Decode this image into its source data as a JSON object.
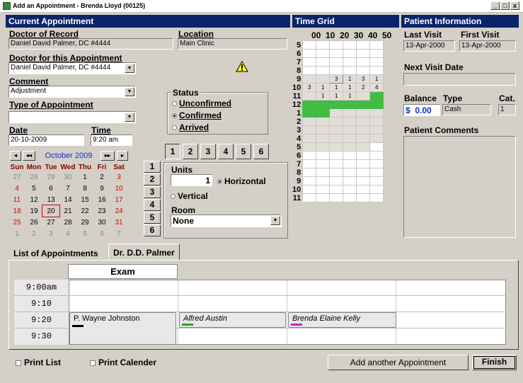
{
  "window": {
    "title": "Add an Appointment - Brenda Lloyd    (00125)",
    "min": "_",
    "max": "□",
    "close": "x"
  },
  "current_appointment": {
    "header": "Current Appointment",
    "doctor_of_record_label": "Doctor of Record",
    "doctor_of_record_value": "Daniel David Palmer, DC #4444",
    "location_label": "Location",
    "location_value": "Main Clinic",
    "doctor_appt_label": "Doctor for this Appointment",
    "doctor_appt_value": "Daniel David Palmer, DC #4444",
    "comment_label": "Comment",
    "comment_value": "Adjustment",
    "type_label": "Type of Appointment",
    "type_value": "",
    "date_label": "Date",
    "date_value": "20-10-2009",
    "time_label": "Time",
    "time_value": "9:20 am",
    "warning_icon": "warning-icon",
    "status": {
      "label": "Status",
      "options": [
        "Unconfirmed",
        "Confirmed",
        "Arrived"
      ],
      "selected": "Confirmed"
    }
  },
  "calendar": {
    "month_label": "October 2009",
    "nav": {
      "prev": "◂",
      "prev_fast": "◂◂",
      "next_fast": "▸▸",
      "next": "▸"
    },
    "weekdays": [
      "Sun",
      "Mon",
      "Tue",
      "Wed",
      "Thu",
      "Fri",
      "Sat"
    ],
    "weeks": [
      [
        "27",
        "28",
        "29",
        "30",
        "1",
        "2",
        "3"
      ],
      [
        "4",
        "5",
        "6",
        "7",
        "8",
        "9",
        "10"
      ],
      [
        "11",
        "12",
        "13",
        "14",
        "15",
        "16",
        "17"
      ],
      [
        "18",
        "19",
        "20",
        "21",
        "22",
        "23",
        "24"
      ],
      [
        "25",
        "26",
        "27",
        "28",
        "29",
        "30",
        "31"
      ],
      [
        "1",
        "2",
        "3",
        "4",
        "5",
        "6",
        "7"
      ]
    ],
    "today": "20"
  },
  "units_panel": {
    "top_tabs": [
      "1",
      "2",
      "3",
      "4",
      "5",
      "6"
    ],
    "side_tabs": [
      "1",
      "2",
      "3",
      "4",
      "5",
      "6"
    ],
    "units_label": "Units",
    "units_value": "1",
    "horizontal_label": "Horizontal",
    "vertical_label": "Vertical",
    "room_label": "Room",
    "room_value": "None"
  },
  "time_grid": {
    "header": "Time Grid",
    "columns": [
      "00",
      "10",
      "20",
      "30",
      "40",
      "50"
    ],
    "hours": [
      "5",
      "6",
      "7",
      "8",
      "9",
      "10",
      "11",
      "12",
      "1",
      "2",
      "3",
      "4",
      "5",
      "6",
      "7",
      "8",
      "9",
      "10",
      "11"
    ],
    "row9": [
      "",
      "",
      "3",
      "1",
      "3",
      "1"
    ],
    "row10": [
      "3",
      "1",
      "1",
      "1",
      "2",
      "4"
    ],
    "row11": [
      "",
      "1",
      "1",
      "1",
      "",
      ""
    ]
  },
  "patient_info": {
    "header": "Patient Information",
    "last_visit_label": "Last Visit",
    "last_visit_value": "13-Apr-2000",
    "first_visit_label": "First Visit",
    "first_visit_value": "13-Apr-2000",
    "next_visit_label": "Next Visit Date",
    "next_visit_value": "",
    "balance_label": "Balance",
    "balance_currency": "$",
    "balance_value": "0.00",
    "type_label": "Type",
    "type_value": "Cash",
    "cat_label": "Cat.",
    "cat_value": "1",
    "comments_label": "Patient Comments"
  },
  "schedule": {
    "tabs": [
      "List of Appointments",
      "Dr. D.D. Palmer"
    ],
    "column_header": "Exam",
    "times": [
      "9:00am",
      "9:10",
      "9:20",
      "9:30"
    ],
    "appointments": [
      {
        "name": "P. Wayne Johnston",
        "color": "#000000"
      },
      {
        "name": "Alfred Austin",
        "color": "#22aa22"
      },
      {
        "name": "Brenda Elaine Kelly",
        "color": "#cc22cc"
      }
    ]
  },
  "footer": {
    "print_list": "Print List",
    "print_calendar": "Print Calender",
    "add_another": "Add another Appointment",
    "finish": "Finish"
  }
}
